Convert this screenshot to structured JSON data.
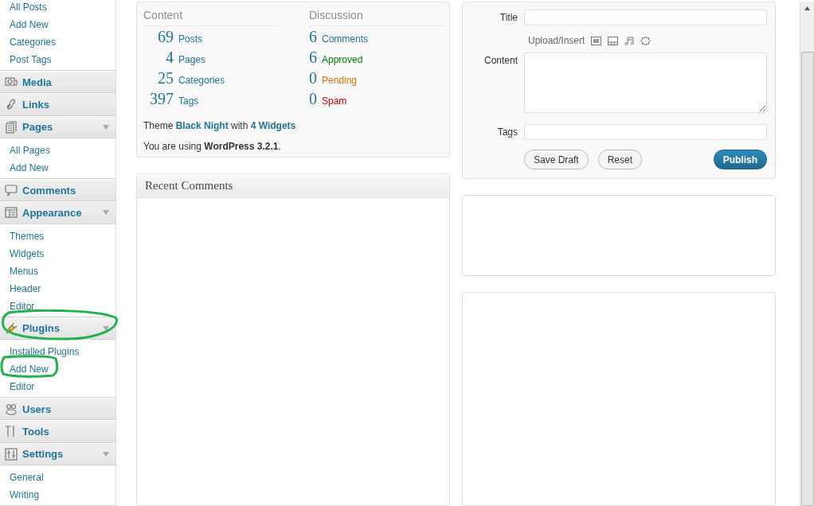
{
  "sidebar": {
    "menus": [
      {
        "items": [
          "All Posts",
          "Add New",
          "Categories",
          "Post Tags"
        ]
      },
      {
        "label": "Media",
        "kind": "media",
        "expanded": false
      },
      {
        "label": "Links",
        "kind": "links",
        "expanded": false
      },
      {
        "label": "Pages",
        "kind": "pages",
        "expanded": true,
        "items": [
          "All Pages",
          "Add New"
        ]
      },
      {
        "label": "Comments",
        "kind": "comments",
        "expanded": false
      },
      {
        "label": "Appearance",
        "kind": "appearance",
        "expanded": true,
        "items": [
          "Themes",
          "Widgets",
          "Menus",
          "Header",
          "Editor"
        ]
      },
      {
        "label": "Plugins",
        "kind": "plugins",
        "expanded": true,
        "items": [
          "Installed Plugins",
          "Add New",
          "Editor"
        ]
      },
      {
        "label": "Users",
        "kind": "users",
        "expanded": false
      },
      {
        "label": "Tools",
        "kind": "tools",
        "expanded": false
      },
      {
        "label": "Settings",
        "kind": "settings",
        "expanded": true,
        "items": [
          "General",
          "Writing"
        ]
      }
    ]
  },
  "right_now": {
    "content_heading": "Content",
    "discussion_heading": "Discussion",
    "content": [
      {
        "count": "69",
        "label": "Posts"
      },
      {
        "count": "4",
        "label": "Pages"
      },
      {
        "count": "25",
        "label": "Categories"
      },
      {
        "count": "397",
        "label": "Tags"
      }
    ],
    "discussion": [
      {
        "count": "6",
        "label": "Comments",
        "color": "#21759b"
      },
      {
        "count": "6",
        "label": "Approved",
        "color": "#008000"
      },
      {
        "count": "0",
        "label": "Pending",
        "color": "#e66f00"
      },
      {
        "count": "0",
        "label": "Spam",
        "color": "#cc0000"
      }
    ],
    "theme_line": "Theme **Black Night** with **4 Widgets**",
    "version_line": "You are using **WordPress 3.2.1**."
  },
  "recent_comments": {
    "title": "Recent Comments"
  },
  "quickpress": {
    "title_label": "Title",
    "upload_label": "Upload/Insert",
    "content_label": "Content",
    "tags_label": "Tags",
    "buttons": [
      {
        "label": "Save Draft",
        "kind": "secondary"
      },
      {
        "label": "Reset",
        "kind": "secondary"
      },
      {
        "label": "Publish",
        "kind": "primary"
      }
    ]
  }
}
